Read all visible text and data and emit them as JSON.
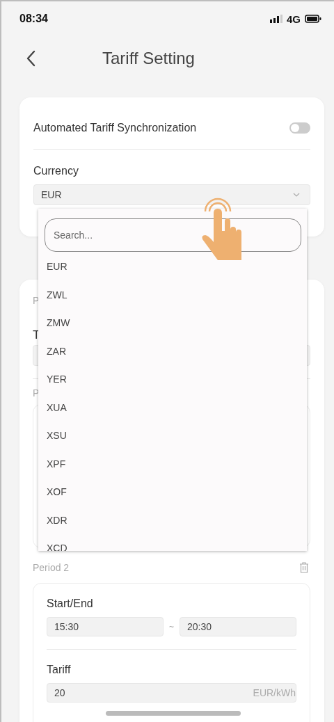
{
  "status_bar": {
    "time": "08:34",
    "network": "4G"
  },
  "header": {
    "title": "Tariff Setting"
  },
  "sync": {
    "label": "Automated Tariff Synchronization",
    "on": false
  },
  "currency": {
    "label": "Currency",
    "value": "EUR"
  },
  "period_1": {
    "label_fragment": "P",
    "field_label_fragment": "T",
    "sub_label_fragment": "P"
  },
  "dropdown": {
    "search": {
      "placeholder": "Search..."
    },
    "options": [
      "EUR",
      "ZWL",
      "ZMW",
      "ZAR",
      "YER",
      "XUA",
      "XSU",
      "XPF",
      "XOF",
      "XDR",
      "XCD"
    ]
  },
  "period_2": {
    "label": "Period 2",
    "start_end_label": "Start/End",
    "start": "15:30",
    "separator": "~",
    "end": "20:30",
    "tariff_label": "Tariff",
    "tariff": "20",
    "unit": "EUR/kWh"
  }
}
